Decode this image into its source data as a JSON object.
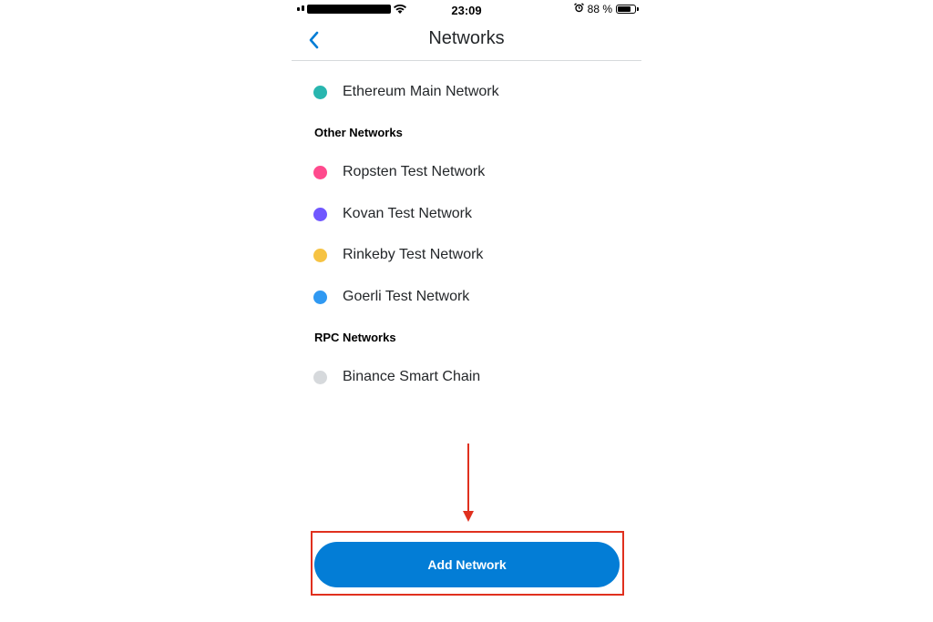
{
  "status_bar": {
    "time": "23:09",
    "battery_percent_label": "88 %",
    "battery_level": 0.88,
    "alarm_icon": "alarm-clock-icon",
    "wifi_icon": "wifi-icon",
    "signal_icon": "cellular-signal-icon"
  },
  "header": {
    "title": "Networks",
    "back_icon": "chevron-left-icon"
  },
  "main_network": {
    "name": "Ethereum Main Network",
    "color": "#29b6af"
  },
  "other_networks": {
    "title": "Other Networks",
    "items": [
      {
        "name": "Ropsten Test Network",
        "color": "#ff4a8d"
      },
      {
        "name": "Kovan Test Network",
        "color": "#7057ff"
      },
      {
        "name": "Rinkeby Test Network",
        "color": "#f6c343"
      },
      {
        "name": "Goerli Test Network",
        "color": "#3099f2"
      }
    ]
  },
  "rpc_networks": {
    "title": "RPC Networks",
    "items": [
      {
        "name": "Binance Smart Chain",
        "color": "#d6d9dc"
      }
    ]
  },
  "actions": {
    "add_network_label": "Add Network",
    "button_color": "#037dd6"
  },
  "annotation": {
    "color": "#e0301e"
  }
}
